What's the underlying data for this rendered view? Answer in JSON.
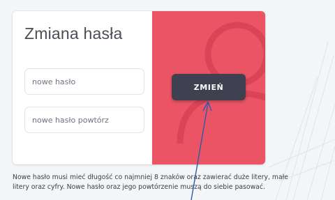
{
  "form": {
    "title": "Zmiana hasła",
    "new_password_placeholder": "nowe hasło",
    "repeat_password_placeholder": "nowe hasło powtórz",
    "submit_label": "ZMIEŃ"
  },
  "note": {
    "line1": "Nowe hasło musi mieć długość co najmniej 8 znaków oraz zawierać duże litery, małe",
    "line2": "litery oraz cyfry. Nowe hasło oraz jego powtórzenie muszą do siebie pasować."
  },
  "colors": {
    "accent_panel": "#ea5465",
    "button": "#3f4150",
    "annotation_arrow": "#2f5aa8"
  },
  "icons": {
    "panel_decoration": "user-silhouette-icon"
  }
}
